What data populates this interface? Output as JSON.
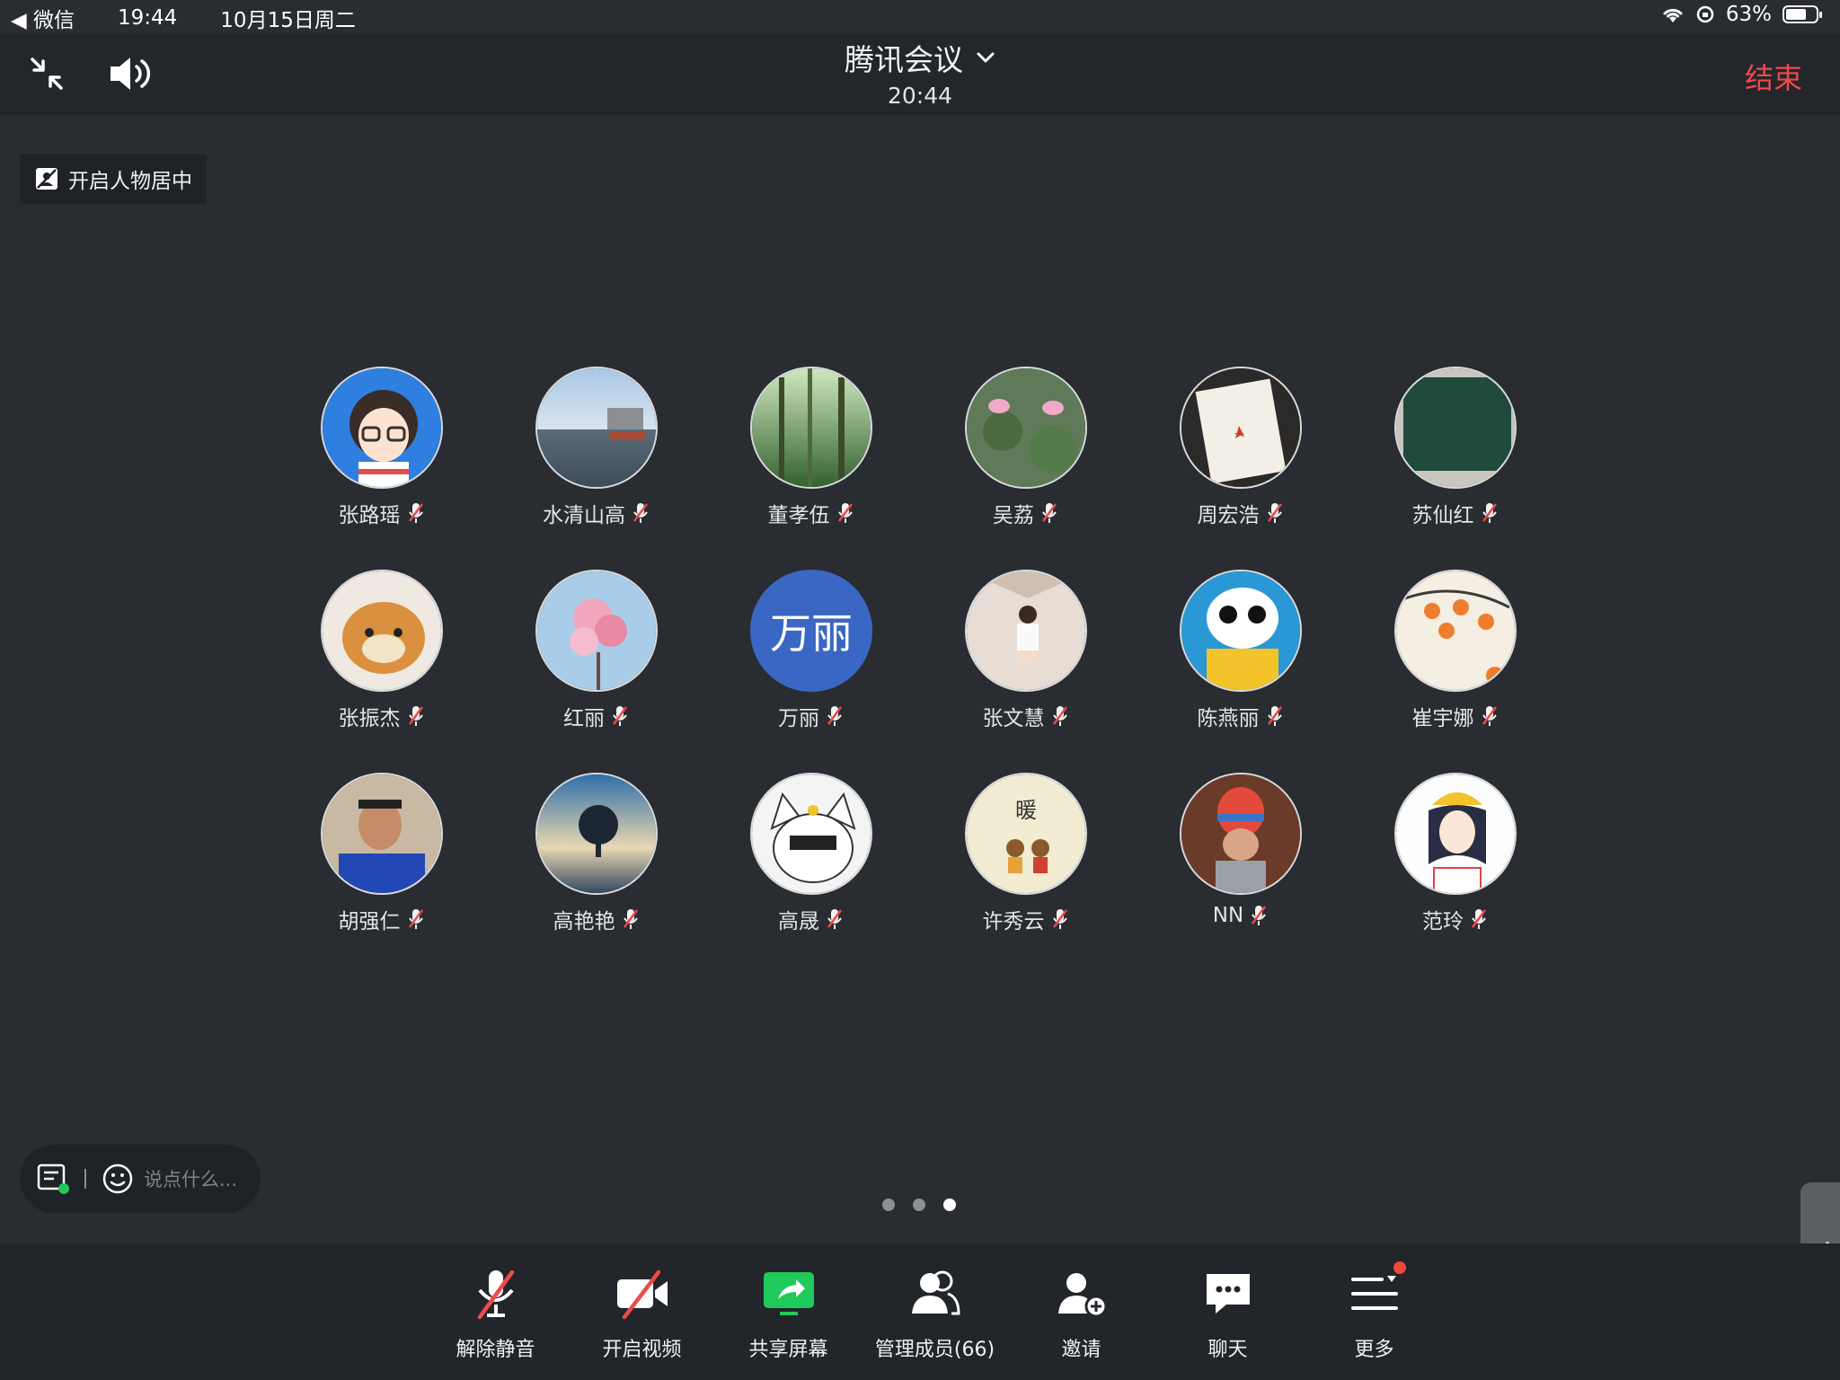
{
  "status_bar": {
    "back_app": "◀ 微信",
    "time": "19:44",
    "date": "10月15日周二",
    "battery": "63%"
  },
  "header": {
    "title": "腾讯会议",
    "clock": "20:44",
    "end_label": "结束"
  },
  "center_toggle": {
    "label": "开启人物居中"
  },
  "participants": [
    {
      "name": "张路瑶",
      "avatar": "cartoon-girl",
      "muted": true
    },
    {
      "name": "水清山高",
      "avatar": "river-city",
      "muted": true
    },
    {
      "name": "董孝伍",
      "avatar": "forest-sunlight",
      "muted": true
    },
    {
      "name": "吴荔",
      "avatar": "lotus-flowers",
      "muted": true
    },
    {
      "name": "周宏浩",
      "avatar": "maple-leaf-card",
      "muted": true
    },
    {
      "name": "苏仙红",
      "avatar": "green-blackboard",
      "muted": true
    },
    {
      "name": "张振杰",
      "avatar": "tiger-cub",
      "muted": true
    },
    {
      "name": "红丽",
      "avatar": "pink-blossoms",
      "muted": true
    },
    {
      "name": "万丽",
      "avatar_text": "万丽",
      "muted": true
    },
    {
      "name": "张文慧",
      "avatar": "girl-photo",
      "muted": true
    },
    {
      "name": "陈燕丽",
      "avatar": "toy-mascot",
      "muted": true
    },
    {
      "name": "崔宇娜",
      "avatar": "persimmon-painting",
      "muted": true
    },
    {
      "name": "胡强仁",
      "avatar": "man-portrait",
      "muted": true
    },
    {
      "name": "高艳艳",
      "avatar": "lone-tree",
      "muted": true
    },
    {
      "name": "高晟",
      "avatar": "cartoon-cat-boy",
      "muted": true
    },
    {
      "name": "许秀云",
      "avatar": "warm-couple",
      "avatar_caption": "暖",
      "muted": true
    },
    {
      "name": "NN",
      "avatar": "child-knit-hat",
      "muted": true
    },
    {
      "name": "范玲",
      "avatar": "illustrated-girl",
      "muted": true
    }
  ],
  "chat": {
    "placeholder": "说点什么..."
  },
  "pagination": {
    "pages": 3,
    "current": 3
  },
  "toolbar": {
    "items": [
      {
        "label": "解除静音",
        "icon": "mic-off-icon"
      },
      {
        "label": "开启视频",
        "icon": "video-off-icon"
      },
      {
        "label": "共享屏幕",
        "icon": "share-screen-icon"
      },
      {
        "label": "管理成员(66)",
        "icon": "members-icon"
      },
      {
        "label": "邀请",
        "icon": "invite-icon"
      },
      {
        "label": "聊天",
        "icon": "chat-icon"
      },
      {
        "label": "更多",
        "icon": "more-icon",
        "has_badge": true
      }
    ]
  },
  "colors": {
    "background": "#292c31",
    "end_red": "#ee4a4a",
    "share_green": "#1fc95a",
    "accent_blue": "#3a67c4"
  }
}
